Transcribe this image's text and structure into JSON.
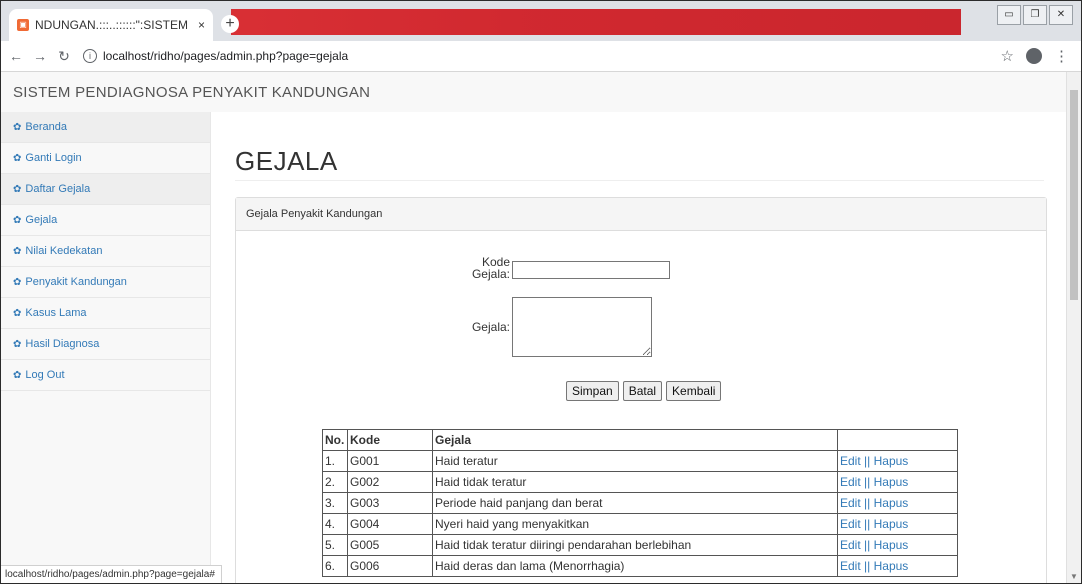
{
  "browser": {
    "tab_title": "NDUNGAN.:::..::::::\":SISTEM P",
    "tab_close": "×",
    "new_tab": "+",
    "address": "localhost/ridho/pages/admin.php?page=gejala",
    "status_url": "localhost/ridho/pages/admin.php?page=gejala#"
  },
  "navbar": {
    "brand": "SISTEM PENDIAGNOSA PENYAKIT KANDUNGAN"
  },
  "sidebar": {
    "icon_glyph": "✿",
    "items": [
      {
        "label": "Beranda"
      },
      {
        "label": "Ganti Login"
      },
      {
        "label": "Daftar Gejala"
      },
      {
        "label": "Gejala"
      },
      {
        "label": "Nilai Kedekatan"
      },
      {
        "label": "Penyakit Kandungan"
      },
      {
        "label": "Kasus Lama"
      },
      {
        "label": "Hasil Diagnosa"
      },
      {
        "label": "Log Out"
      }
    ]
  },
  "main": {
    "title": "GEJALA",
    "panel_heading": "Gejala Penyakit Kandungan",
    "form": {
      "kode_label_1": "Kode",
      "kode_label_2": "Gejala",
      "kode_value": "",
      "gejala_label": "Gejala",
      "gejala_value": ""
    },
    "buttons": {
      "simpan": "Simpan",
      "batal": "Batal",
      "kembali": "Kembali"
    },
    "table": {
      "headers": [
        "No.",
        "Kode",
        "Gejala",
        ""
      ],
      "edit": "Edit",
      "sep": "||",
      "hapus": "Hapus",
      "rows": [
        {
          "no": "1.",
          "kode": "G001",
          "gejala": "Haid teratur"
        },
        {
          "no": "2.",
          "kode": "G002",
          "gejala": "Haid tidak teratur"
        },
        {
          "no": "3.",
          "kode": "G003",
          "gejala": "Periode haid panjang dan berat"
        },
        {
          "no": "4.",
          "kode": "G004",
          "gejala": "Nyeri haid yang menyakitkan"
        },
        {
          "no": "5.",
          "kode": "G005",
          "gejala": "Haid tidak teratur diiringi pendarahan berlebihan"
        },
        {
          "no": "6.",
          "kode": "G006",
          "gejala": "Haid deras dan lama (Menorrhagia)"
        }
      ]
    }
  },
  "colors": {
    "link": "#337ab7",
    "tabstrip_overlay": "#d8262b"
  }
}
